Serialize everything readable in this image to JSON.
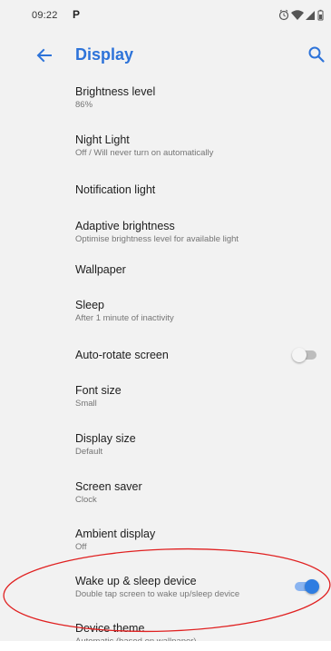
{
  "status_bar": {
    "time": "09:22",
    "app_icon": "P",
    "icons": [
      "alarm-icon",
      "wifi-icon",
      "signal-icon",
      "battery-icon"
    ]
  },
  "app_bar": {
    "title": "Display",
    "back_icon": "arrow-left",
    "search_icon": "magnifier"
  },
  "settings": [
    {
      "title": "Brightness level",
      "summary": "86%"
    },
    {
      "title": "Night Light",
      "summary": "Off / Will never turn on automatically"
    },
    {
      "title": "Notification light",
      "summary": ""
    },
    {
      "title": "Adaptive brightness",
      "summary": "Optimise brightness level for available light"
    },
    {
      "title": "Wallpaper",
      "summary": ""
    },
    {
      "title": "Sleep",
      "summary": "After 1 minute of inactivity"
    },
    {
      "title": "Auto-rotate screen",
      "summary": "",
      "toggle": "off"
    },
    {
      "title": "Font size",
      "summary": "Small"
    },
    {
      "title": "Display size",
      "summary": "Default"
    },
    {
      "title": "Screen saver",
      "summary": "Clock"
    },
    {
      "title": "Ambient display",
      "summary": "Off"
    },
    {
      "title": "Wake up & sleep device",
      "summary": "Double tap screen to wake up/sleep device",
      "toggle": "on"
    },
    {
      "title": "Device theme",
      "summary": "Automatic (based on wallpaper)"
    }
  ],
  "colors": {
    "accent": "#2d73d9",
    "annotation": "#e02020",
    "background": "#f2f2f2"
  }
}
